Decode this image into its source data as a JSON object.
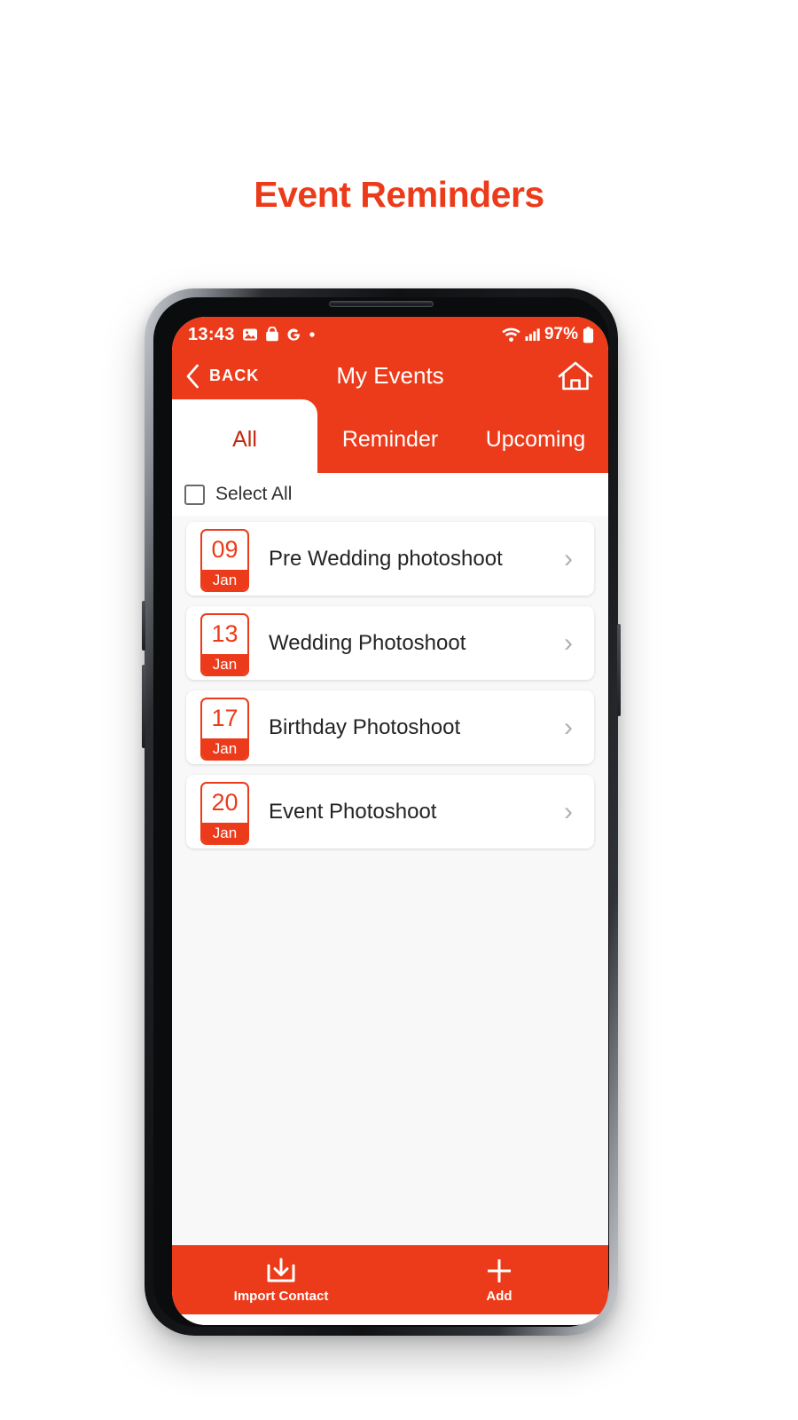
{
  "page": {
    "title": "Event Reminders",
    "accent_color": "#ec3b1a",
    "content_bg": "#f8f8f8"
  },
  "status_bar": {
    "time": "13:43",
    "left_icons": [
      "photo-icon",
      "bag-icon",
      "google-g-icon",
      "dot-icon"
    ],
    "right_icons": [
      "wifi-icon",
      "cellular-signal-icon",
      "battery-icon"
    ],
    "battery_percent": "97%"
  },
  "app_bar": {
    "back_label": "BACK",
    "back_icon": "chevron-left-icon",
    "title": "My Events",
    "home_icon": "home-icon"
  },
  "tabs": [
    {
      "label": "All",
      "active": true
    },
    {
      "label": "Reminder",
      "active": false
    },
    {
      "label": "Upcoming",
      "active": false
    }
  ],
  "select_all": {
    "label": "Select All",
    "checked": false
  },
  "events": [
    {
      "day": "09",
      "month": "Jan",
      "title": "Pre Wedding photoshoot",
      "chevron": "›"
    },
    {
      "day": "13",
      "month": "Jan",
      "title": "Wedding Photoshoot",
      "chevron": "›"
    },
    {
      "day": "17",
      "month": "Jan",
      "title": "Birthday Photoshoot",
      "chevron": "›"
    },
    {
      "day": "20",
      "month": "Jan",
      "title": "Event Photoshoot",
      "chevron": "›"
    }
  ],
  "bottom_bar": {
    "actions": [
      {
        "label": "Import Contact",
        "icon": "download-icon"
      },
      {
        "label": "Add",
        "icon": "plus-icon"
      }
    ]
  }
}
